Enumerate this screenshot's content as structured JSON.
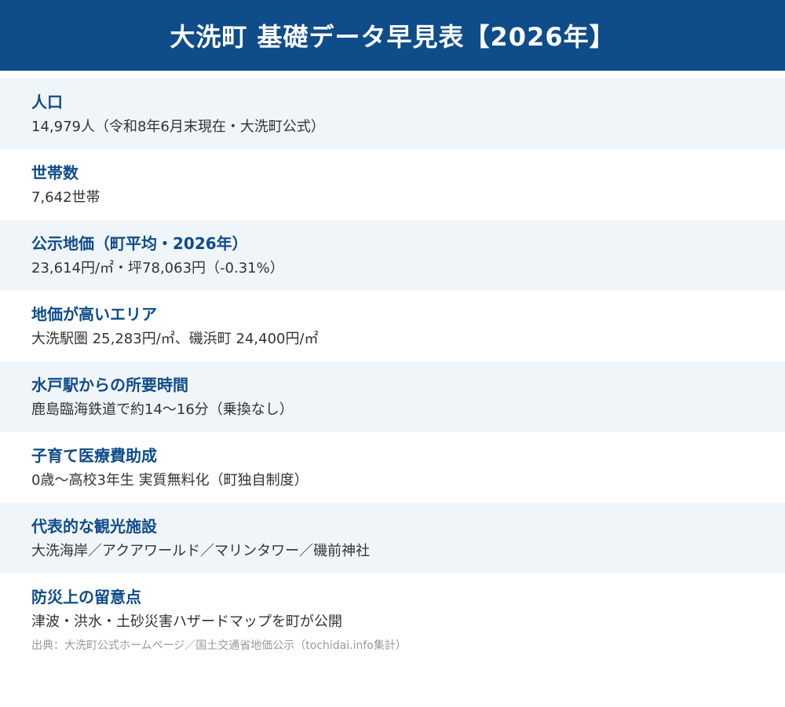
{
  "page": {
    "title": "大洗町 基礎データ早見表【2026年】"
  },
  "rows": [
    {
      "label": "人口",
      "value": "14,979人（令和8年6月末現在・大洗町公式）"
    },
    {
      "label": "世帯数",
      "value": "7,642世帯"
    },
    {
      "label": "公示地価（町平均・2026年）",
      "value": "23,614円/㎡・坪78,063円（-0.31%）"
    },
    {
      "label": "地価が高いエリア",
      "value": "大洗駅圏 25,283円/㎡、磯浜町 24,400円/㎡"
    },
    {
      "label": "水戸駅からの所要時間",
      "value": "鹿島臨海鉄道で約14〜16分（乗換なし）"
    },
    {
      "label": "子育て医療費助成",
      "value": "0歳〜高校3年生 実質無料化（町独自制度）"
    },
    {
      "label": "代表的な観光施設",
      "value": "大洗海岸／アクアワールド／マリンタワー／磯前神社"
    },
    {
      "label": "防災上の留意点",
      "value": "津波・洪水・土砂災害ハザードマップを町が公開"
    }
  ],
  "source": "出典：大洗町公式ホームページ／国土交通省地価公示（tochidai.info集計）",
  "colors": {
    "header_bg": "#0f4c8a",
    "label": "#0f4c8a",
    "row_shade": "#f0f5fa"
  }
}
